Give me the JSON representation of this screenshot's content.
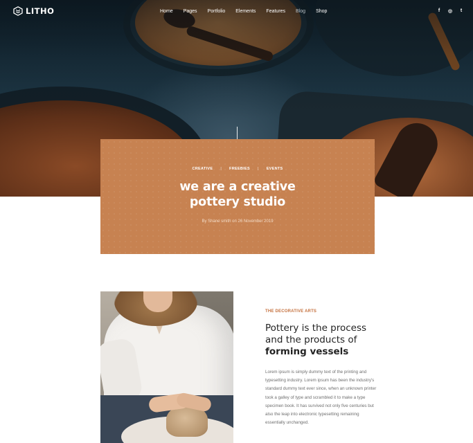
{
  "brand": {
    "name": "LITHO"
  },
  "nav": {
    "items": [
      {
        "label": "Home"
      },
      {
        "label": "Pages"
      },
      {
        "label": "Portfolio"
      },
      {
        "label": "Elements"
      },
      {
        "label": "Features"
      },
      {
        "label": "Blog",
        "active": true
      },
      {
        "label": "Shop"
      }
    ]
  },
  "social": [
    {
      "icon": "facebook-icon",
      "glyph": "f"
    },
    {
      "icon": "instagram-icon",
      "glyph": "◎"
    },
    {
      "icon": "twitter-icon",
      "glyph": "t"
    }
  ],
  "post": {
    "categories": [
      "CREATIVE",
      "FREEBIES",
      "EVENTS"
    ],
    "separator": "|",
    "title_line1": "we are a creative",
    "title_line2": "pottery studio",
    "byline": "By Shane smith on 26 November 2019"
  },
  "section": {
    "eyebrow": "THE DECORATIVE ARTS",
    "heading_line1": "Pottery is the process",
    "heading_line2": "and the products of",
    "heading_line3": "forming vessels",
    "body": "Lorem ipsum is simply dummy text of the printing and typesetting industry. Lorem ipsum has been the industry's standard dummy text ever since, when an unknown printer took a galley of type and scrambled it to make a type specimen book. It has survived not only five centuries but also the leap into electronic typesetting remaining essentially unchanged."
  },
  "colors": {
    "accent": "#c78251",
    "eyebrow": "#c5713e",
    "heading": "#232323",
    "body": "#6f6f6f"
  }
}
